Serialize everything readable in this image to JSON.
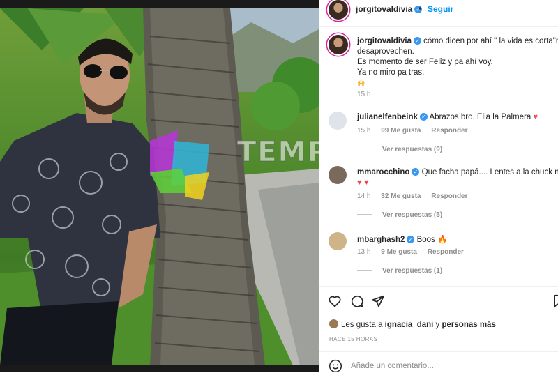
{
  "post": {
    "username": "jorgitovaldivia",
    "follow_label": "Seguir",
    "separator": "•",
    "caption_lines": [
      "cómo dicen por ahí \" la vida es corta\"no l",
      "desaprovechen.",
      "Es momento de ser Feliz y pa ahí voy.",
      "Ya no miro pa tras."
    ],
    "caption_emoji": "🙌",
    "caption_time": "15 h"
  },
  "watermark": "TEMPOX",
  "comments": [
    {
      "username": "julianelfenbeink",
      "text": "Abrazos bro. Ella la Palmera",
      "emoji": "♥",
      "time": "15 h",
      "likes": "99 Me gusta",
      "reply": "Responder",
      "view_replies": "Ver respuestas (9)"
    },
    {
      "username": "mmarocchino",
      "text": "Que facha papá.... Lentes a la chuck norris",
      "emoji": "♥ ♥",
      "time": "14 h",
      "likes": "32 Me gusta",
      "reply": "Responder",
      "view_replies": "Ver respuestas (5)"
    },
    {
      "username": "mbarghash2",
      "text": "Boos",
      "emoji": "🔥",
      "time": "13 h",
      "likes": "9 Me gusta",
      "reply": "Responder",
      "view_replies": "Ver respuestas (1)"
    }
  ],
  "likes_line": {
    "prefix": "Les gusta a",
    "user": "ignacia_dani",
    "connector": "y",
    "more": "personas más"
  },
  "posted_ago": "HACE 15 HORAS",
  "add_comment_placeholder": "Añade un comentario...",
  "icons": [
    "heart-icon",
    "comment-icon",
    "share-icon",
    "bookmark-icon",
    "emoji-icon",
    "verified-icon",
    "more-icon"
  ],
  "colors": {
    "accent": "#0095f6",
    "verified": "#3897f0",
    "like_red": "#ed4956",
    "muted": "#8e8e8e"
  }
}
